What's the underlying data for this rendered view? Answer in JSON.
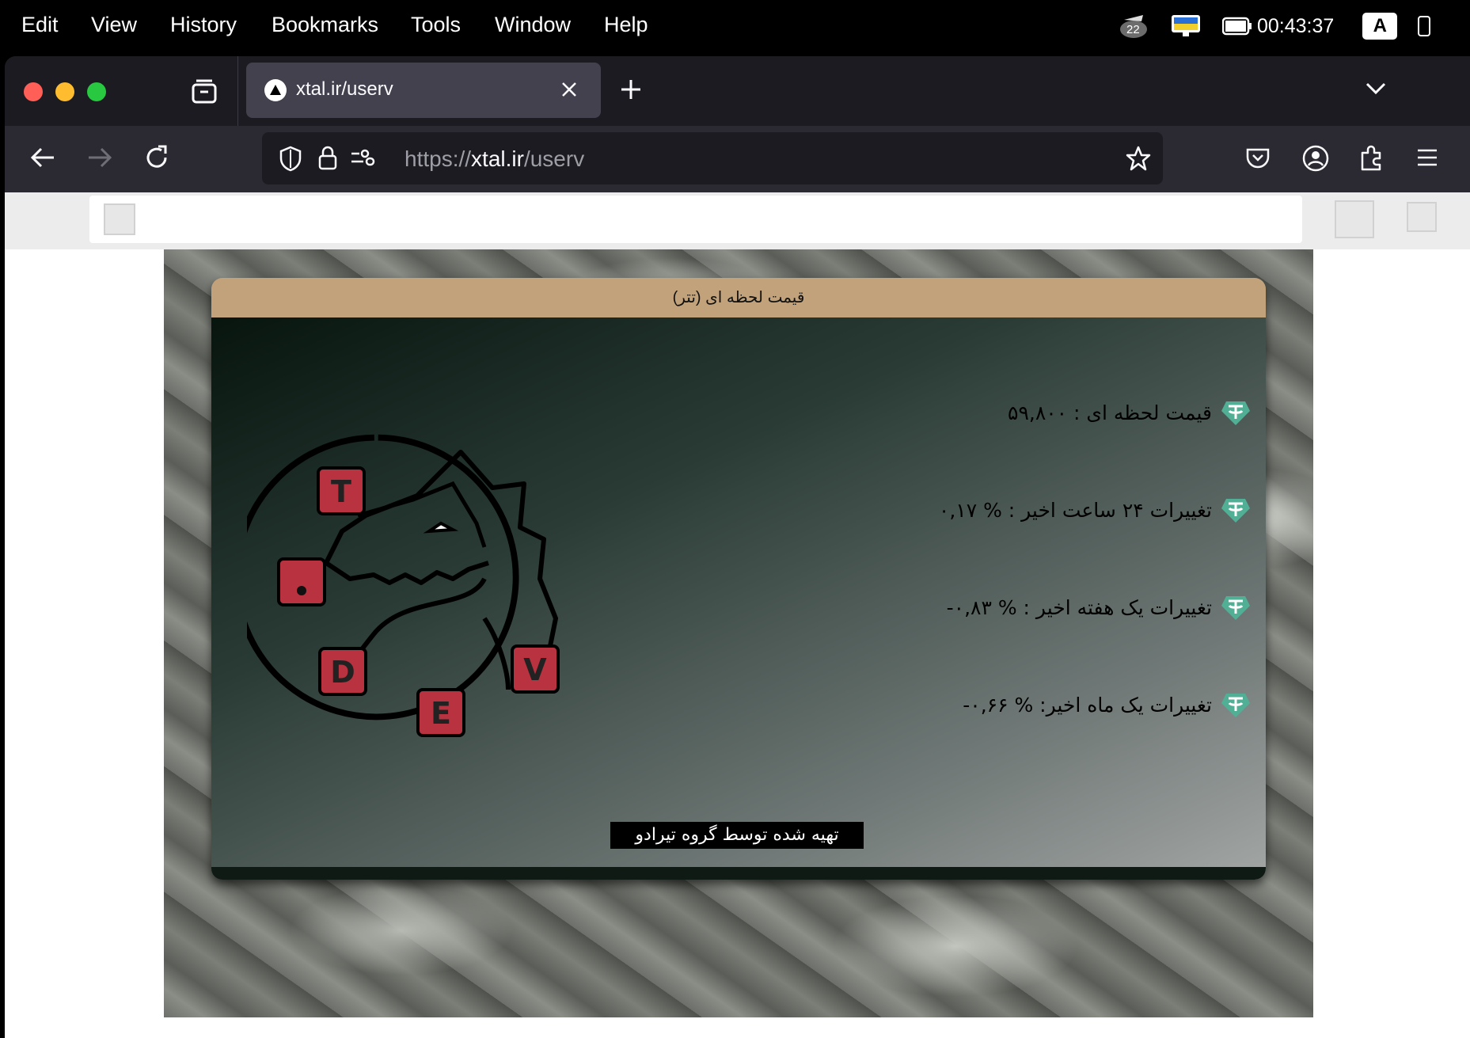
{
  "menubar": {
    "items": [
      "Edit",
      "View",
      "History",
      "Bookmarks",
      "Tools",
      "Window",
      "Help"
    ],
    "badge": "22",
    "clock": "00:43:37",
    "input_source": "A"
  },
  "browser": {
    "tab_title": "xtal.ir/userv",
    "url_prefix": "https://",
    "url_host": "xtal.ir",
    "url_path": "/userv"
  },
  "page": {
    "card_title": "قیمت لحظه ای (تتر)",
    "rows": [
      "قیمت لحظه ای  :  ۵۹,۸۰۰",
      "تغییرات ۲۴ ساعت اخیر : % ۰,۱۷",
      "تغییرات یک هفته اخیر : % ۰,۸۳-",
      "تغییرات یک ماه اخیر: % ۰,۶۶-"
    ],
    "credit": "تهیه شده توسط گروه تیرادو",
    "logo_letters": [
      "T",
      ".",
      "D",
      "E",
      "V"
    ],
    "colors": {
      "header": "#c1a27a",
      "tether": "#50af95",
      "logo_tile": "#b8323f"
    }
  }
}
